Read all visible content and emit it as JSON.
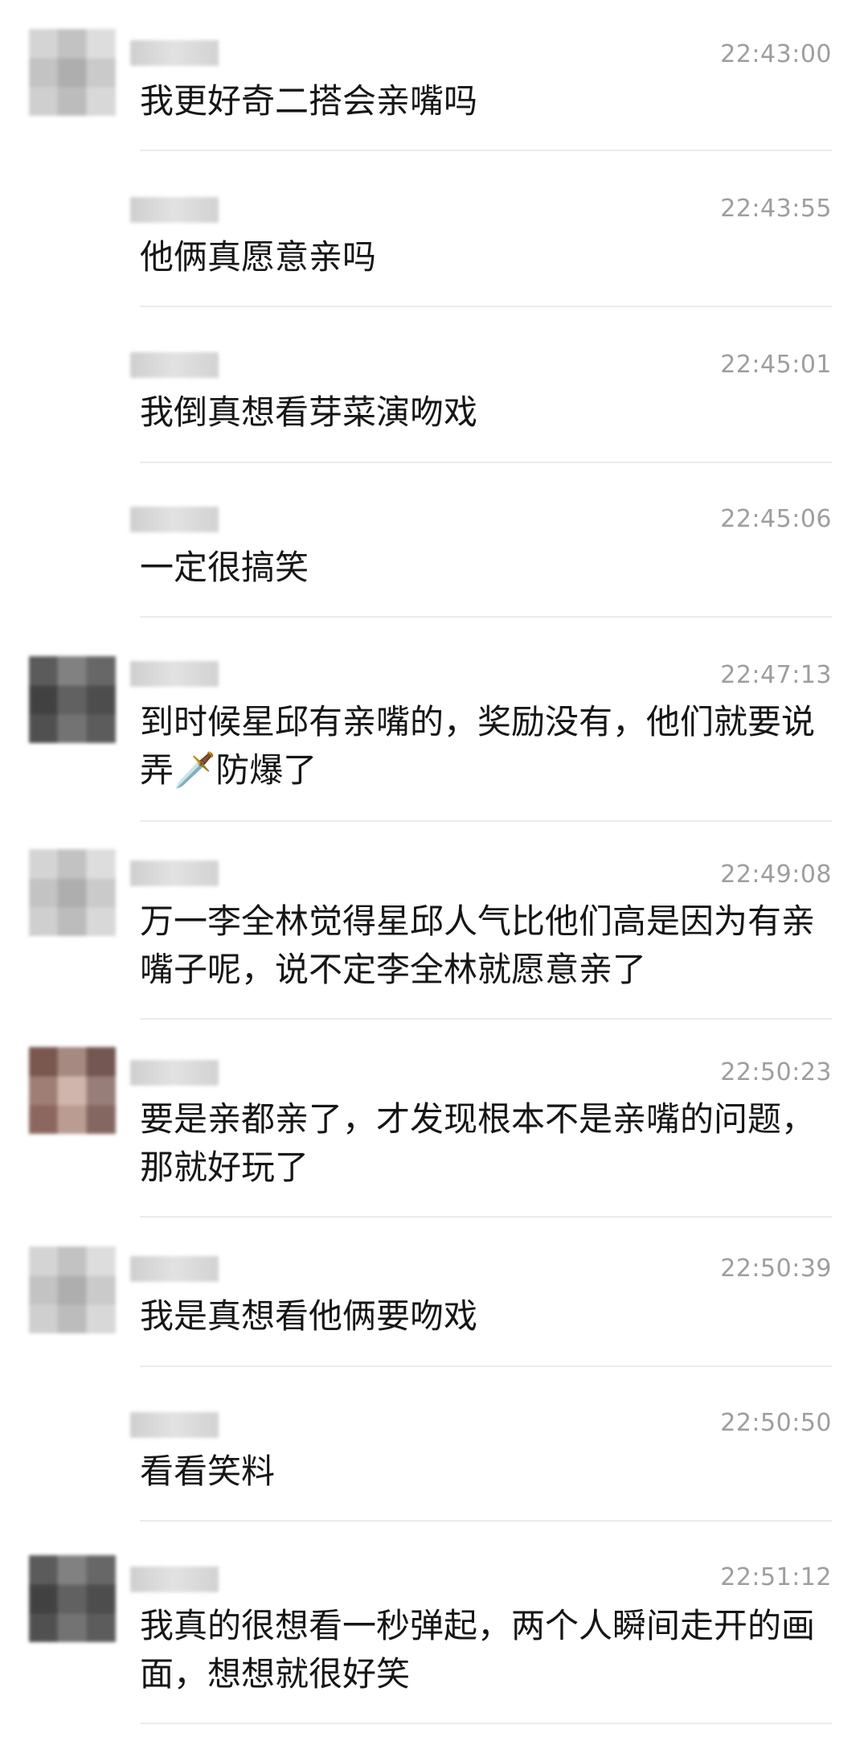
{
  "messages": [
    {
      "time": "22:43:00",
      "text": "我更好奇二搭会亲嘴吗"
    },
    {
      "time": "22:43:55",
      "text": "他俩真愿意亲吗"
    },
    {
      "time": "22:45:01",
      "text": "我倒真想看芽菜演吻戏"
    },
    {
      "time": "22:45:06",
      "text": "一定很搞笑"
    },
    {
      "time": "22:47:13",
      "text": "到时候星邱有亲嘴的，奖励没有，他们就要说弄🗡️防爆了"
    },
    {
      "time": "22:49:08",
      "text": "万一李全林觉得星邱人气比他们高是因为有亲嘴子呢，说不定李全林就愿意亲了"
    },
    {
      "time": "22:50:23",
      "text": "要是亲都亲了，才发现根本不是亲嘴的问题，那就好玩了"
    },
    {
      "time": "22:50:39",
      "text": "我是真想看他俩要吻戏"
    },
    {
      "time": "22:50:50",
      "text": "看看笑料"
    },
    {
      "time": "22:51:12",
      "text": "我真的很想看一秒弹起，两个人瞬间走开的画面，想想就很好笑"
    }
  ]
}
